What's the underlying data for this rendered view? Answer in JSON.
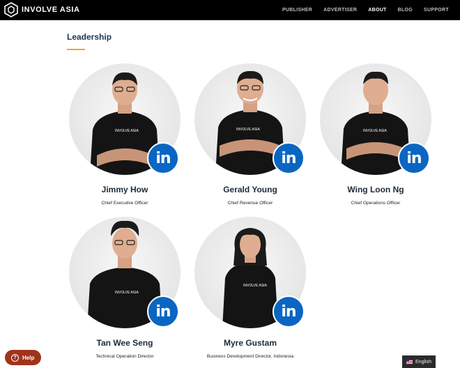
{
  "brand": {
    "name": "INVOLVE ASIA"
  },
  "nav": {
    "items": [
      {
        "label": "PUBLISHER",
        "active": false
      },
      {
        "label": "ADVERTISER",
        "active": false
      },
      {
        "label": "ABOUT",
        "active": true
      },
      {
        "label": "BLOG",
        "active": false
      },
      {
        "label": "SUPPORT",
        "active": false
      }
    ]
  },
  "section": {
    "title": "Leadership"
  },
  "leaders": [
    {
      "name": "Jimmy How",
      "role": "Chief Executive Officer",
      "linkedin_label": "in",
      "shirt_text": "INVOLVE ASIA"
    },
    {
      "name": "Gerald Young",
      "role": "Chief Revenue Officer",
      "linkedin_label": "in",
      "shirt_text": "INVOLVE ASIA"
    },
    {
      "name": "Wing Loon Ng",
      "role": "Chief Operations Officer",
      "linkedin_label": "in",
      "shirt_text": "INVOLVE ASIA"
    },
    {
      "name": "Tan Wee Seng",
      "role": "Technical Operation Director",
      "linkedin_label": "in",
      "shirt_text": "INVOLVE ASIA"
    },
    {
      "name": "Myre Gustam",
      "role": "Business Development Director, Indonesia",
      "linkedin_label": "in",
      "shirt_text": "INVOLVE ASIA"
    }
  ],
  "help": {
    "label": "Help",
    "icon_glyph": "?"
  },
  "language": {
    "label": "English"
  },
  "colors": {
    "topbar": "#000000",
    "title": "#1d3557",
    "accent": "#f0a23b",
    "linkedin": "#0a66c2",
    "help": "#a0341b"
  }
}
